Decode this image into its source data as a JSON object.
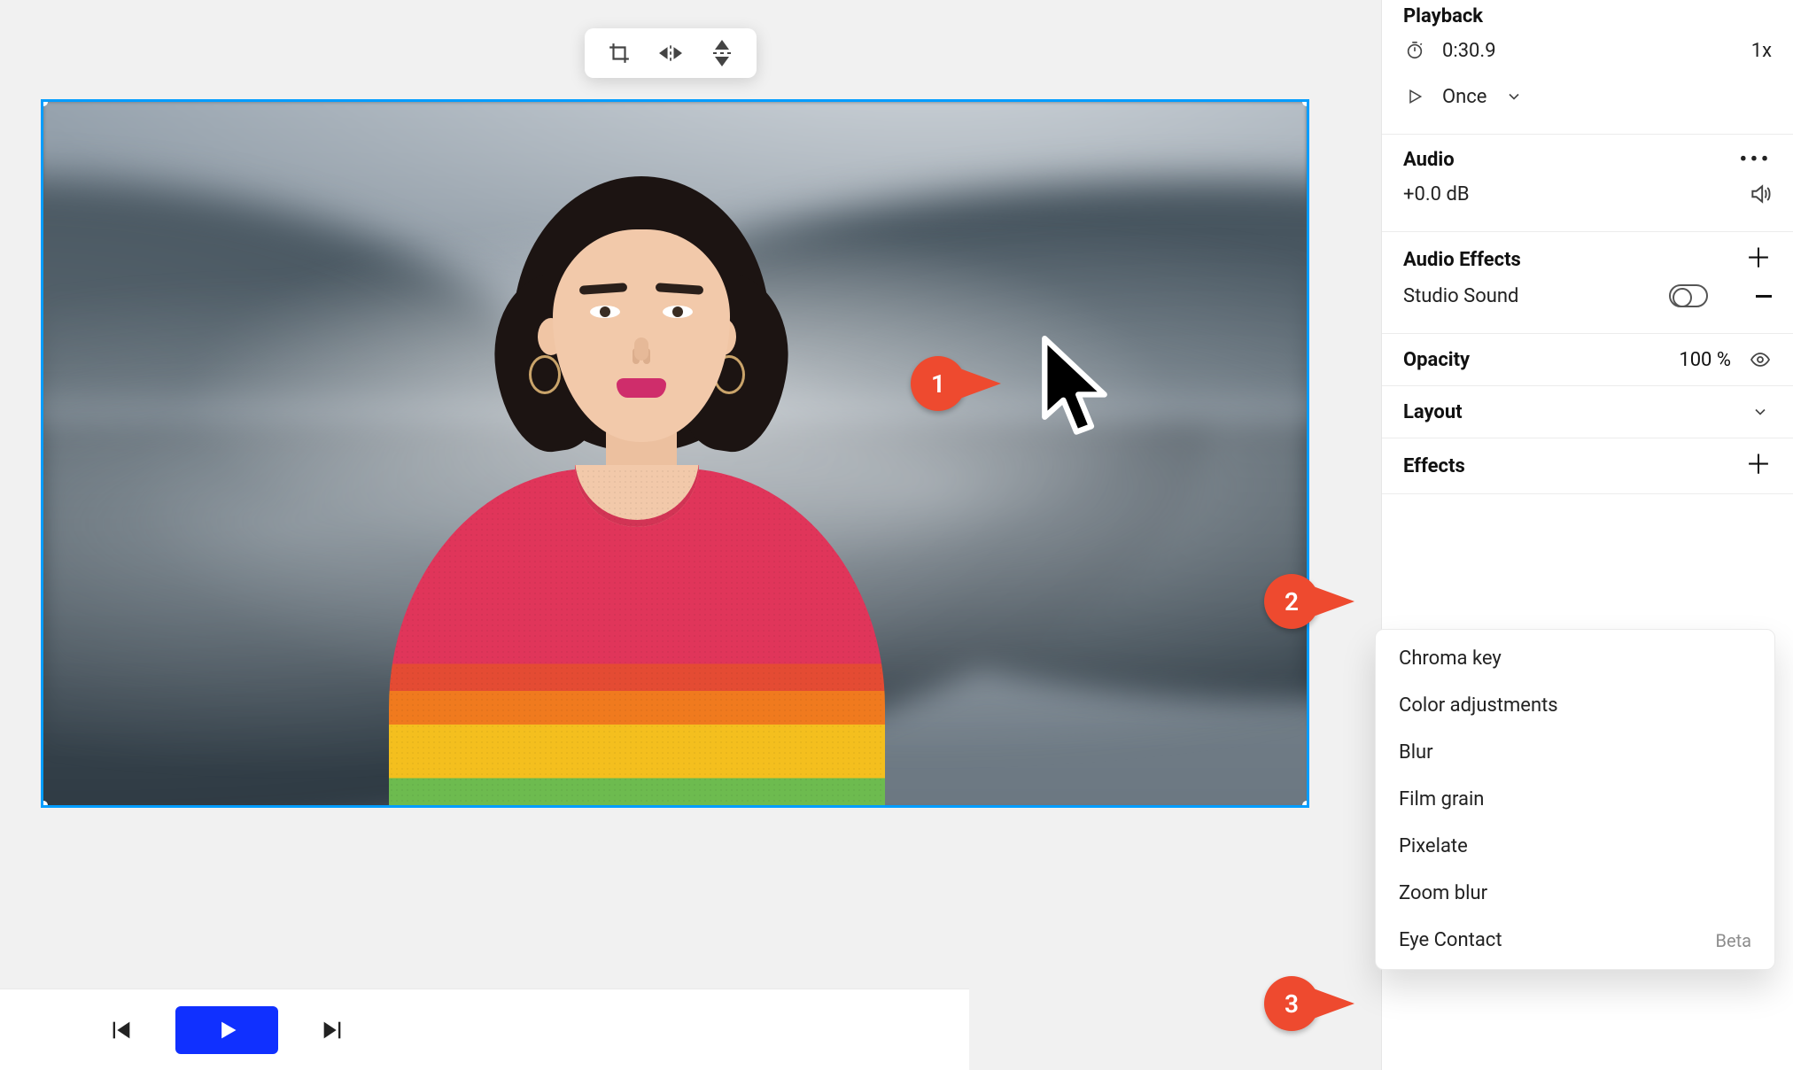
{
  "toolbar": {
    "crop": "crop",
    "flip_h": "flip-horizontal",
    "flip_v": "flip-vertical"
  },
  "annotations": {
    "m1": "1",
    "m2": "2",
    "m3": "3"
  },
  "panel": {
    "playback": {
      "title": "Playback",
      "time": "0:30.9",
      "speed": "1x",
      "loop_label": "Once"
    },
    "audio": {
      "title": "Audio",
      "gain": "+0.0 dB"
    },
    "audio_effects": {
      "title": "Audio Effects",
      "item": "Studio Sound"
    },
    "opacity": {
      "title": "Opacity",
      "value": "100 %"
    },
    "layout": {
      "title": "Layout"
    },
    "effects": {
      "title": "Effects",
      "menu": [
        {
          "label": "Chroma key"
        },
        {
          "label": "Color adjustments"
        },
        {
          "label": "Blur"
        },
        {
          "label": "Film grain"
        },
        {
          "label": "Pixelate"
        },
        {
          "label": "Zoom blur"
        },
        {
          "label": "Eye Contact",
          "badge": "Beta"
        }
      ]
    }
  },
  "playbar": {
    "prev": "previous",
    "play": "play",
    "next": "next"
  }
}
